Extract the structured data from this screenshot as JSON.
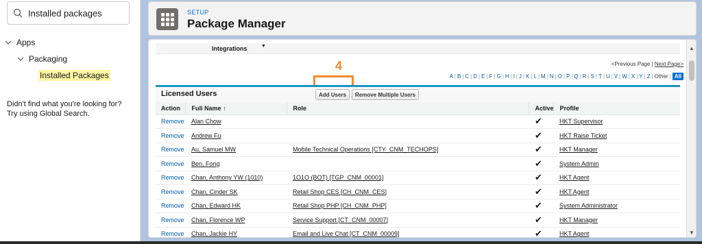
{
  "sidebar": {
    "search_value": "Installed packages",
    "tree": [
      {
        "label": "Apps",
        "level": 1,
        "expanded": true
      },
      {
        "label": "Packaging",
        "level": 2,
        "expanded": true
      },
      {
        "label": "Installed Packages",
        "level": 3,
        "highlighted": true
      }
    ],
    "help_line1": "Didn't find what you're looking for?",
    "help_line2": "Try using Global Search."
  },
  "header": {
    "eyebrow": "SETUP",
    "title": "Package Manager"
  },
  "integrations": {
    "label": "Integrations"
  },
  "pager": {
    "prev": "<Previous Page",
    "sep": "|",
    "next": "Next Page>"
  },
  "alphabet": [
    "A",
    "B",
    "C",
    "D",
    "E",
    "F",
    "G",
    "H",
    "I",
    "J",
    "K",
    "L",
    "M",
    "N",
    "O",
    "P",
    "Q",
    "R",
    "S",
    "T",
    "U",
    "V",
    "W",
    "X",
    "Y",
    "Z",
    "Other",
    "All"
  ],
  "annotation": {
    "number": "4",
    "color": "#f28b2c"
  },
  "licensed_users": {
    "title": "Licensed Users",
    "add_button": "Add Users",
    "remove_multiple_button": "Remove Multiple Users",
    "columns": [
      "Action",
      "Full Name ↑",
      "Role",
      "Active",
      "Profile"
    ],
    "rows": [
      {
        "action": "Remove",
        "name": "Alan Chow",
        "role": "",
        "active": "✔",
        "profile": "HKT Supervisor"
      },
      {
        "action": "Remove",
        "name": "Andrew Fu",
        "role": "",
        "active": "✔",
        "profile": "HKT Raise Ticket"
      },
      {
        "action": "Remove",
        "name": "Au, Samuel MW",
        "role": "Mobile Technical Operations [CTY_CNM_TECHOPS]",
        "active": "✔",
        "profile": "HKT Manager"
      },
      {
        "action": "Remove",
        "name": "Ben, Fong",
        "role": "",
        "active": "✔",
        "profile": "System Admin"
      },
      {
        "action": "Remove",
        "name": "Chan, Anthony YW (1010)",
        "role": "1O1O (BOT) [TGP_CNM_00001]",
        "active": "✔",
        "profile": "HKT Agent"
      },
      {
        "action": "Remove",
        "name": "Chan, Cinder SK",
        "role": "Retail Shop CES [CH_CNM_CES]",
        "active": "✔",
        "profile": "HKT Agent"
      },
      {
        "action": "Remove",
        "name": "Chan, Edward HK",
        "role": "Retail Shop PHP [CH_CNM_PHP]",
        "active": "✔",
        "profile": "System Administrator"
      },
      {
        "action": "Remove",
        "name": "Chan, Florence WP",
        "role": "Service Support [CT_CNM_00007]",
        "active": "✔",
        "profile": "HKT Manager"
      },
      {
        "action": "Remove",
        "name": "Chan, Jackie HY",
        "role": "Email and Live Chat [CT_CNM_00009]",
        "active": "✔",
        "profile": "HKT Agent"
      }
    ]
  },
  "colors": {
    "accent": "#0070d2",
    "panel_border": "#1797c0",
    "highlight": "#fdf6a3"
  }
}
